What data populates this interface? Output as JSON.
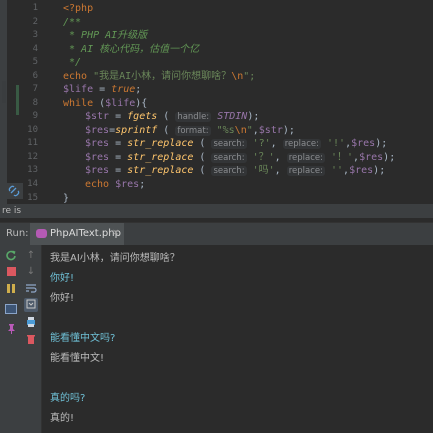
{
  "editor": {
    "line_numbers": [
      "1",
      "2",
      "3",
      "4",
      "5",
      "6",
      "7",
      "8",
      "9",
      "10",
      "11",
      "12",
      "13",
      "14",
      "15"
    ],
    "lines": {
      "l1": "<?php",
      "l2": "/**",
      "l3": " * PHP AI升级版",
      "l4": " * AI 核心代码，估值一个亿",
      "l5": " */",
      "l6_kw": "echo",
      "l6_str": "\"我是AI小林，请问你想聊啥？",
      "l6_esc": "\\n",
      "l6_end": "\";",
      "l7_var": "$life",
      "l7_eq": " = ",
      "l7_kw": "true",
      "l7_end": ";",
      "l8_kw": "while",
      "l8_a": " (",
      "l8_var": "$life",
      "l8_b": "){",
      "l9_var": "$str",
      "l9_eq": " = ",
      "l9_fn": "fgets",
      "l9_a": " ( ",
      "l9_hint": "handle:",
      "l9_const": "STDIN",
      "l9_b": ");",
      "l10_var": "$res",
      "l10_eq": "=",
      "l10_fn": "sprintf",
      "l10_a": " ( ",
      "l10_hint": "format:",
      "l10_str": "\"%s",
      "l10_esc": "\\n",
      "l10_str2": "\"",
      "l10_comma": ",",
      "l10_var2": "$str",
      "l10_b": ");",
      "l11_var": "$res",
      "l11_eq": " = ",
      "l11_fn": "str_replace",
      "l11_a": " ( ",
      "l11_hint1": "search:",
      "l11_s1": "'?'",
      "l11_c1": ", ",
      "l11_hint2": "replace:",
      "l11_s2": "'!'",
      "l11_c2": ",",
      "l11_var2": "$res",
      "l11_b": ");",
      "l12_var": "$res",
      "l12_eq": " = ",
      "l12_fn": "str_replace",
      "l12_a": " ( ",
      "l12_hint1": "search:",
      "l12_s1": "'？'",
      "l12_c1": ", ",
      "l12_hint2": "replace:",
      "l12_s2": "'！'",
      "l12_c2": ",",
      "l12_var2": "$res",
      "l12_b": ");",
      "l13_var": "$res",
      "l13_eq": " = ",
      "l13_fn": "str_replace",
      "l13_a": " ( ",
      "l13_hint1": "search:",
      "l13_s1": "'吗'",
      "l13_c1": ", ",
      "l13_hint2": "replace:",
      "l13_s2": "''",
      "l13_c2": ",",
      "l13_var2": "$res",
      "l13_b": ");",
      "l14_kw": "echo",
      "l14_sp": " ",
      "l14_var": "$res",
      "l14_end": ";",
      "l15": "}"
    }
  },
  "status": {
    "text": "re is"
  },
  "run": {
    "label": "Run:",
    "tab_name": "PhpAIText.php",
    "tab_close": "×"
  },
  "console": {
    "lines": [
      {
        "text": "我是AI小林，请问你想聊啥？",
        "kind": "output"
      },
      {
        "text": "你好!",
        "kind": "input"
      },
      {
        "text": "你好!",
        "kind": "output"
      },
      {
        "text": "",
        "kind": "output"
      },
      {
        "text": "能看懂中文吗?",
        "kind": "input"
      },
      {
        "text": "能看懂中文!",
        "kind": "output"
      },
      {
        "text": "",
        "kind": "output"
      },
      {
        "text": "真的吗?",
        "kind": "input"
      },
      {
        "text": "真的!",
        "kind": "output"
      }
    ]
  },
  "colors": {
    "keyword": "#cc7832",
    "variable": "#9876aa",
    "string": "#6a8759",
    "comment": "#629755",
    "function": "#ffc66d",
    "console_input": "#6fc0d6",
    "console_output": "#bbbbbb"
  },
  "icons": {
    "rerun": "rerun-icon",
    "stop": "stop-icon",
    "pause": "pause-icon",
    "layout": "layout-icon",
    "pin": "pin-icon",
    "up": "arrow-up-icon",
    "down": "arrow-down-icon",
    "soft_wrap": "soft-wrap-icon",
    "scroll_end": "scroll-to-end-icon",
    "print": "print-icon",
    "trash": "trash-icon",
    "link": "link-icon"
  }
}
